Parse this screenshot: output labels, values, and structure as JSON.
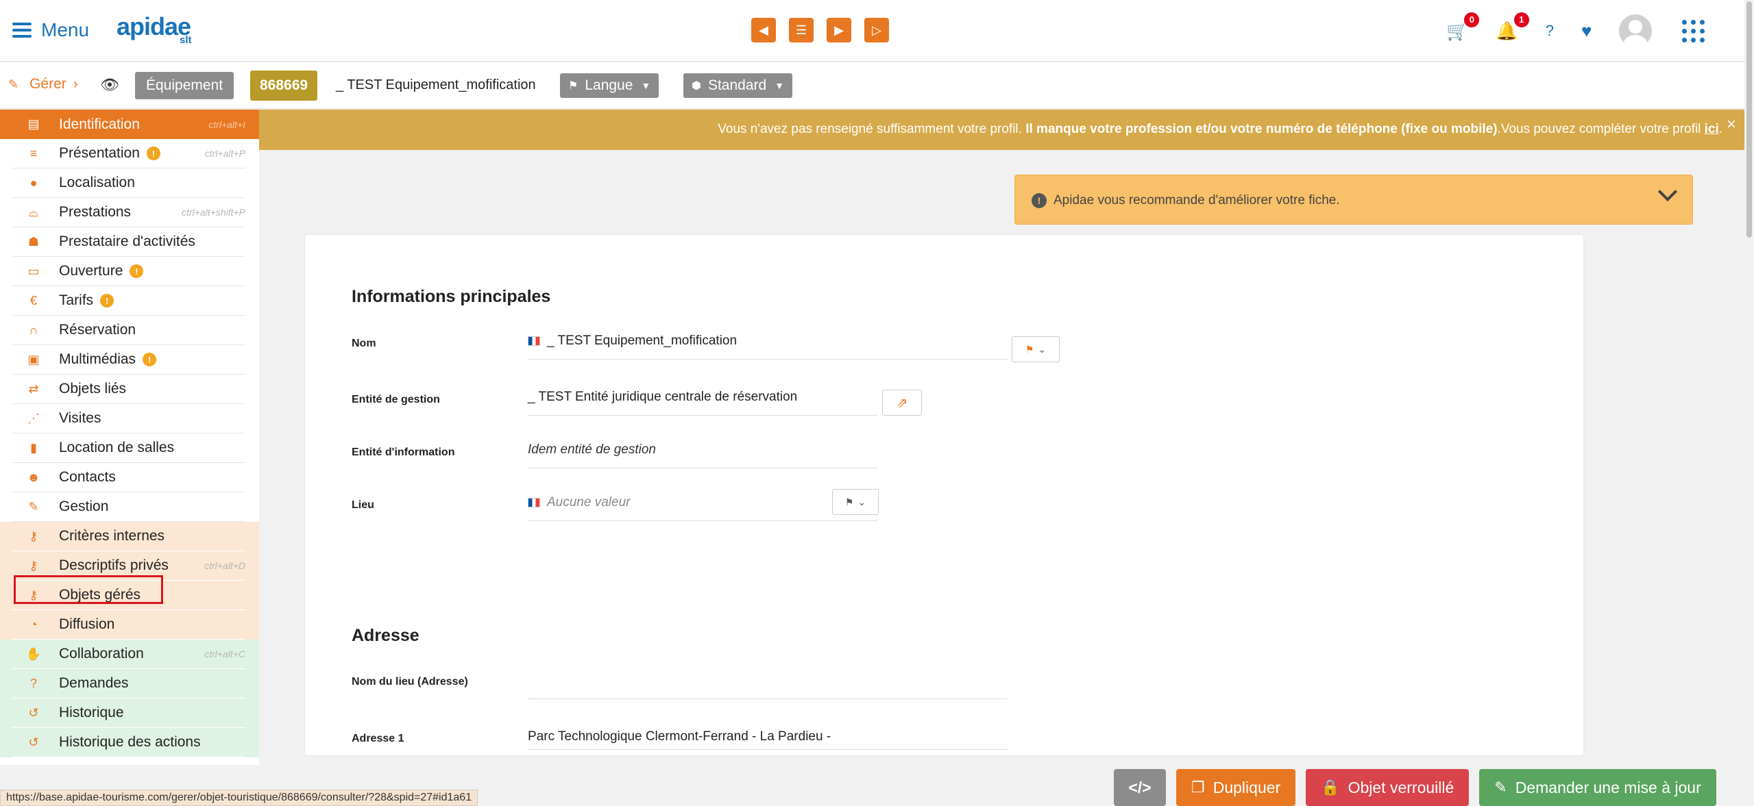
{
  "header": {
    "menu_label": "Menu",
    "logo_text": "apidae",
    "logo_sub": "slt",
    "nav_buttons": [
      "first-icon",
      "list-icon",
      "next-icon",
      "last-icon"
    ],
    "cart_count": "0",
    "notifications_count": "1",
    "help_label": "?"
  },
  "subbar": {
    "gerer_label": "Gérer",
    "type_tag": "Équipement",
    "object_id": "868669",
    "object_name": "_ TEST Equipement_mofification",
    "langue_label": "Langue",
    "standard_label": "Standard"
  },
  "sidebar": {
    "items": [
      {
        "label": "Identification",
        "shortcut": "ctrl+alt+I",
        "icon": "id-card-icon",
        "warn": false
      },
      {
        "label": "Présentation",
        "shortcut": "ctrl+alt+P",
        "icon": "lines-icon",
        "warn": true
      },
      {
        "label": "Localisation",
        "shortcut": "",
        "icon": "map-pin-icon",
        "warn": false
      },
      {
        "label": "Prestations",
        "shortcut": "ctrl+alt+shift+P",
        "icon": "bell-service-icon",
        "warn": false
      },
      {
        "label": "Prestataire d'activités",
        "shortcut": "",
        "icon": "hiker-icon",
        "warn": false
      },
      {
        "label": "Ouverture",
        "shortcut": "",
        "icon": "calendar-icon",
        "warn": true
      },
      {
        "label": "Tarifs",
        "shortcut": "",
        "icon": "euro-icon",
        "warn": true
      },
      {
        "label": "Réservation",
        "shortcut": "",
        "icon": "headset-icon",
        "warn": false
      },
      {
        "label": "Multimédias",
        "shortcut": "",
        "icon": "images-icon",
        "warn": true
      },
      {
        "label": "Objets liés",
        "shortcut": "",
        "icon": "exchange-icon",
        "warn": false
      },
      {
        "label": "Visites",
        "shortcut": "",
        "icon": "footprints-icon",
        "warn": false
      },
      {
        "label": "Location de salles",
        "shortcut": "",
        "icon": "bookmark-icon",
        "warn": false
      },
      {
        "label": "Contacts",
        "shortcut": "",
        "icon": "users-icon",
        "warn": false
      },
      {
        "label": "Gestion",
        "shortcut": "",
        "icon": "wrench-icon",
        "warn": false
      },
      {
        "label": "Critères internes",
        "shortcut": "",
        "icon": "key-icon",
        "warn": false
      },
      {
        "label": "Descriptifs privés",
        "shortcut": "ctrl+alt+D",
        "icon": "key-icon",
        "warn": false
      },
      {
        "label": "Objets gérés",
        "shortcut": "",
        "icon": "key-icon",
        "warn": false
      },
      {
        "label": "Diffusion",
        "shortcut": "",
        "icon": "rss-icon",
        "warn": false
      },
      {
        "label": "Collaboration",
        "shortcut": "ctrl+alt+C",
        "icon": "handshake-icon",
        "warn": false
      },
      {
        "label": "Demandes",
        "shortcut": "",
        "icon": "question-circle-icon",
        "warn": false
      },
      {
        "label": "Historique",
        "shortcut": "",
        "icon": "history-icon",
        "warn": false
      },
      {
        "label": "Historique des actions",
        "shortcut": "",
        "icon": "history-icon",
        "warn": false
      }
    ]
  },
  "banner": {
    "text_1": "Vous n'avez pas renseigné suffisamment votre profil. ",
    "text_bold": "Il manque votre profession et/ou votre numéro de téléphone (fixe ou mobile)",
    "text_2": ".Vous pouvez compléter votre profil ",
    "link": "ici",
    "text_end": ".",
    "close": "×"
  },
  "recommendation": {
    "text": "Apidae vous recommande d'améliorer votre fiche."
  },
  "form": {
    "section_main": "Informations principales",
    "nom_label": "Nom",
    "nom_value": "_ TEST Equipement_mofification",
    "entite_gestion_label": "Entité de gestion",
    "entite_gestion_value": "_ TEST Entité juridique centrale de réservation",
    "entite_info_label": "Entité d'information",
    "entite_info_value": "Idem entité de gestion",
    "lieu_label": "Lieu",
    "lieu_placeholder": "Aucune valeur",
    "section_adresse": "Adresse",
    "nom_lieu_label": "Nom du lieu (Adresse)",
    "nom_lieu_value": "",
    "adresse1_label": "Adresse 1",
    "adresse1_value": "Parc Technologique Clermont-Ferrand - La Pardieu -"
  },
  "actions": {
    "code_label": "</>",
    "duplicate_label": "Dupliquer",
    "locked_label": "Objet verrouillé",
    "update_label": "Demander une mise à jour"
  },
  "status_url": "https://base.apidae-tourisme.com/gerer/objet-touristique/868669/consulter/?28&spid=27#id1a61",
  "colors": {
    "accent": "#e87722",
    "brand_blue": "#1a73b8",
    "banner": "#d6a94a",
    "recommendation": "#f9c06a",
    "danger": "#d9434b",
    "success": "#5aa55f"
  }
}
